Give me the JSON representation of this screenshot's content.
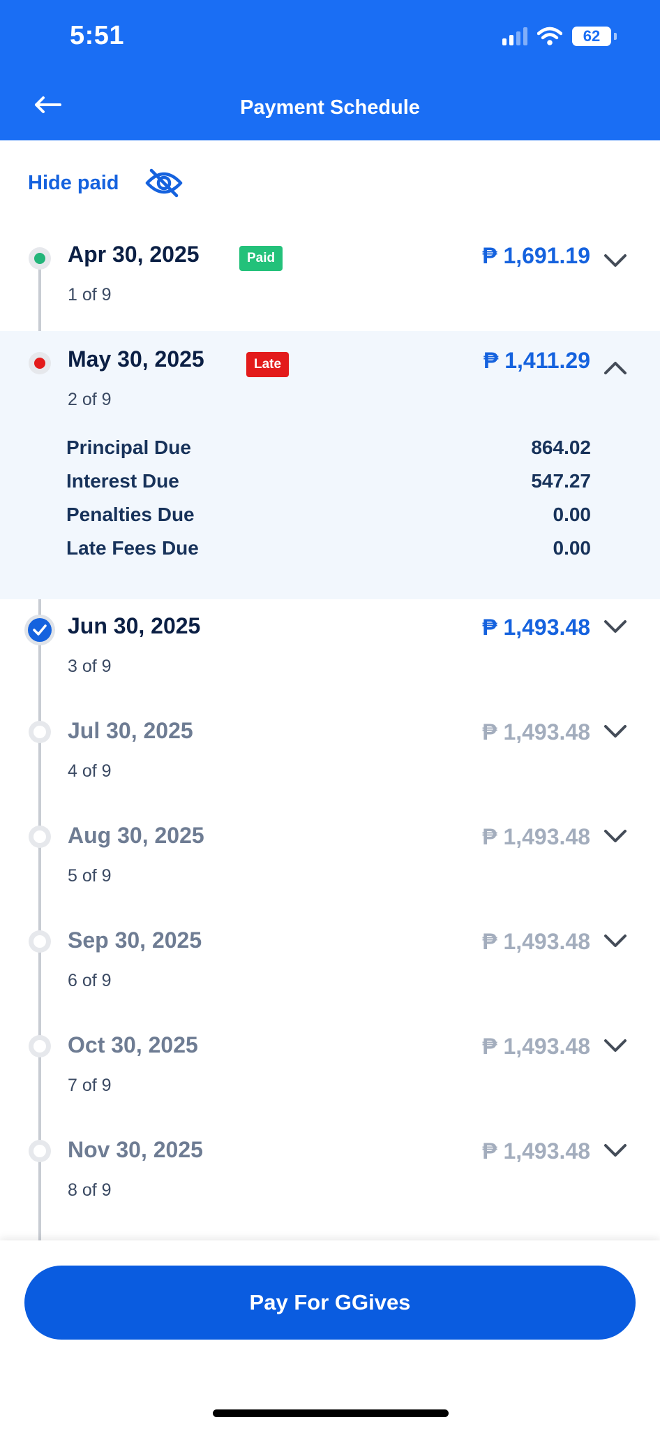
{
  "status_bar": {
    "time": "5:51",
    "battery": "62"
  },
  "header": {
    "title": "Payment Schedule",
    "back_icon": "arrow-left-icon"
  },
  "hide_paid": {
    "label": "Hide paid",
    "icon": "eye-off-icon"
  },
  "currency_symbol": "₱",
  "payments": [
    {
      "date": "Apr 30, 2025",
      "count": "1 of 9",
      "badge": "Paid",
      "amount": "₱ 1,691.19"
    },
    {
      "date": "May 30, 2025",
      "count": "2 of 9",
      "badge": "Late",
      "amount": "₱ 1,411.29",
      "breakdown": [
        {
          "label": "Principal Due",
          "value": "864.02"
        },
        {
          "label": "Interest Due",
          "value": "547.27"
        },
        {
          "label": "Penalties Due",
          "value": "0.00"
        },
        {
          "label": "Late Fees Due",
          "value": "0.00"
        }
      ]
    },
    {
      "date": "Jun 30, 2025",
      "count": "3 of 9",
      "amount": "₱ 1,493.48"
    },
    {
      "date": "Jul 30, 2025",
      "count": "4 of 9",
      "amount": "₱ 1,493.48"
    },
    {
      "date": "Aug 30, 2025",
      "count": "5 of 9",
      "amount": "₱ 1,493.48"
    },
    {
      "date": "Sep 30, 2025",
      "count": "6 of 9",
      "amount": "₱ 1,493.48"
    },
    {
      "date": "Oct 30, 2025",
      "count": "7 of 9",
      "amount": "₱ 1,493.48"
    },
    {
      "date": "Nov 30, 2025",
      "count": "8 of 9",
      "amount": "₱ 1,493.48"
    }
  ],
  "cta": {
    "label": "Pay For GGives"
  },
  "colors": {
    "brand": "#1a6ef4",
    "paid": "#23c17a",
    "late": "#e31b1b",
    "link": "#1562de"
  }
}
